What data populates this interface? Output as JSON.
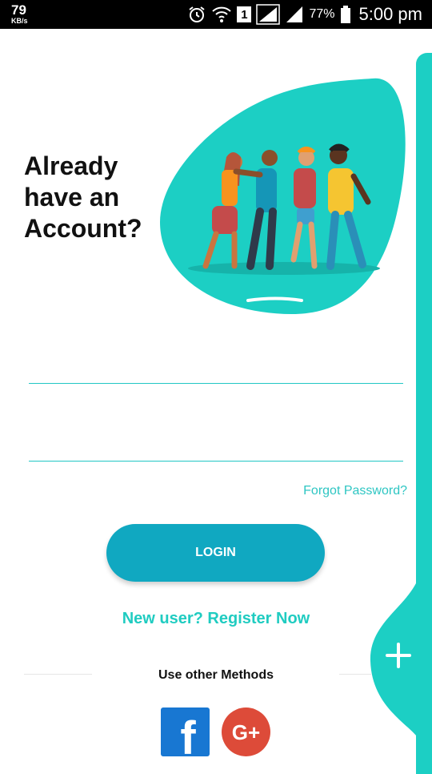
{
  "status_bar": {
    "speed_value": "79",
    "speed_unit": "KB/s",
    "sim_slot": "1",
    "battery_percent": "77%",
    "time": "5:00 pm",
    "icons": [
      "alarm-icon",
      "wifi-icon",
      "signal-icon",
      "battery-icon"
    ]
  },
  "title": {
    "line1": "Already",
    "line2": "have an",
    "line3": "Account?"
  },
  "form": {
    "email_value": "",
    "email_placeholder": "",
    "password_value": "",
    "password_placeholder": ""
  },
  "forgot_password": "Forgot Password?",
  "login_button": "LOGIN",
  "register_link": "New user? Register Now",
  "other_methods_label": "Use other Methods",
  "social": {
    "facebook_glyph": "f",
    "google_glyph": "G+"
  },
  "fab": {
    "icon": "plus-icon"
  },
  "colors": {
    "accent": "#1ccfc4",
    "button": "#10a8c1",
    "link": "#2ec6c3",
    "facebook": "#1877d2",
    "google": "#dd4b39"
  }
}
